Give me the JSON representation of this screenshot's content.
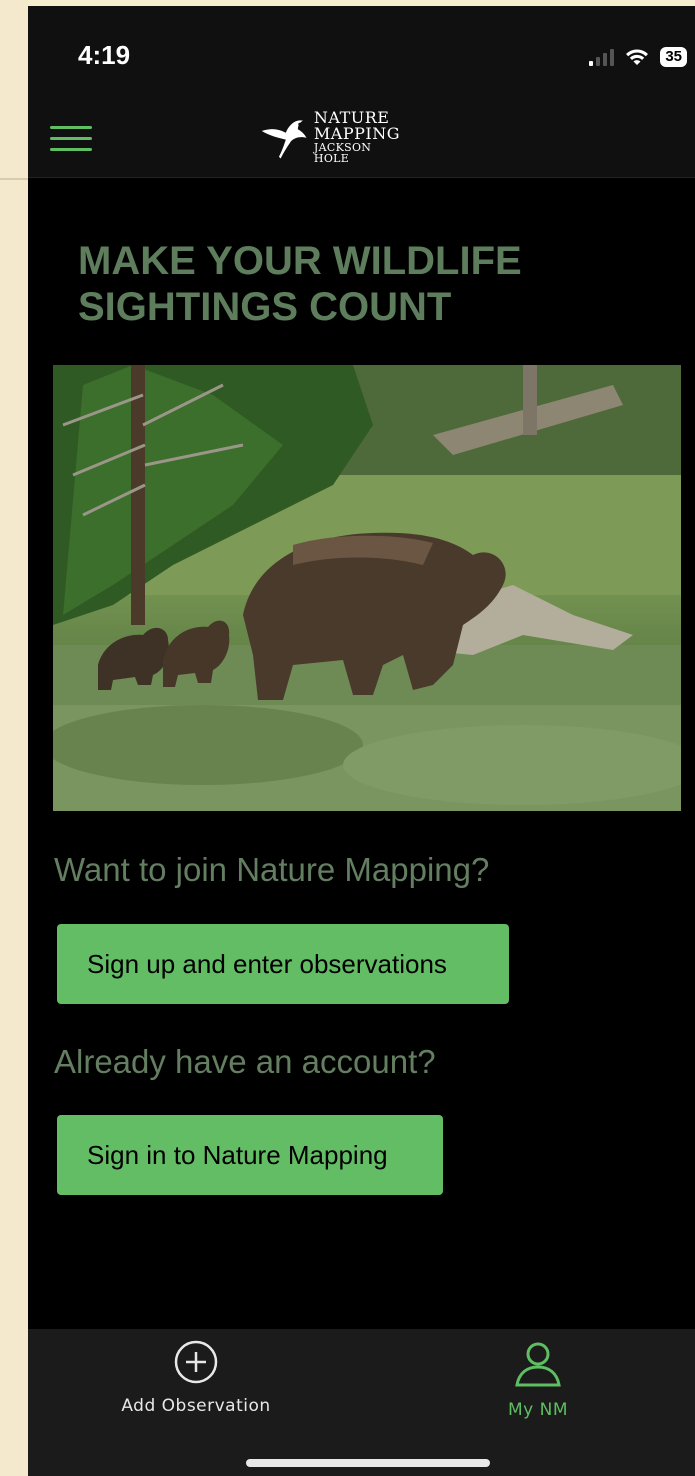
{
  "status_bar": {
    "time": "4:19",
    "battery": "35"
  },
  "header": {
    "menu_icon": "hamburger-icon",
    "logo": {
      "line1": "NATURE",
      "line2": "MAPPING",
      "line3": "JACKSON HOLE"
    }
  },
  "main": {
    "headline": "MAKE YOUR WILDLIFE SIGHTINGS COUNT",
    "join_question": "Want to join Nature Mapping?",
    "signup_button": "Sign up and enter observations",
    "account_question": "Already have an account?",
    "signin_button": "Sign in to Nature Mapping"
  },
  "tab_bar": {
    "tabs": [
      {
        "label": "Add Observation",
        "icon": "plus-circle-icon"
      },
      {
        "label": "My NM",
        "icon": "person-icon",
        "active": true
      }
    ]
  },
  "colors": {
    "accent": "#63bd65",
    "heading": "#5e7d5c",
    "background": "#000000"
  }
}
